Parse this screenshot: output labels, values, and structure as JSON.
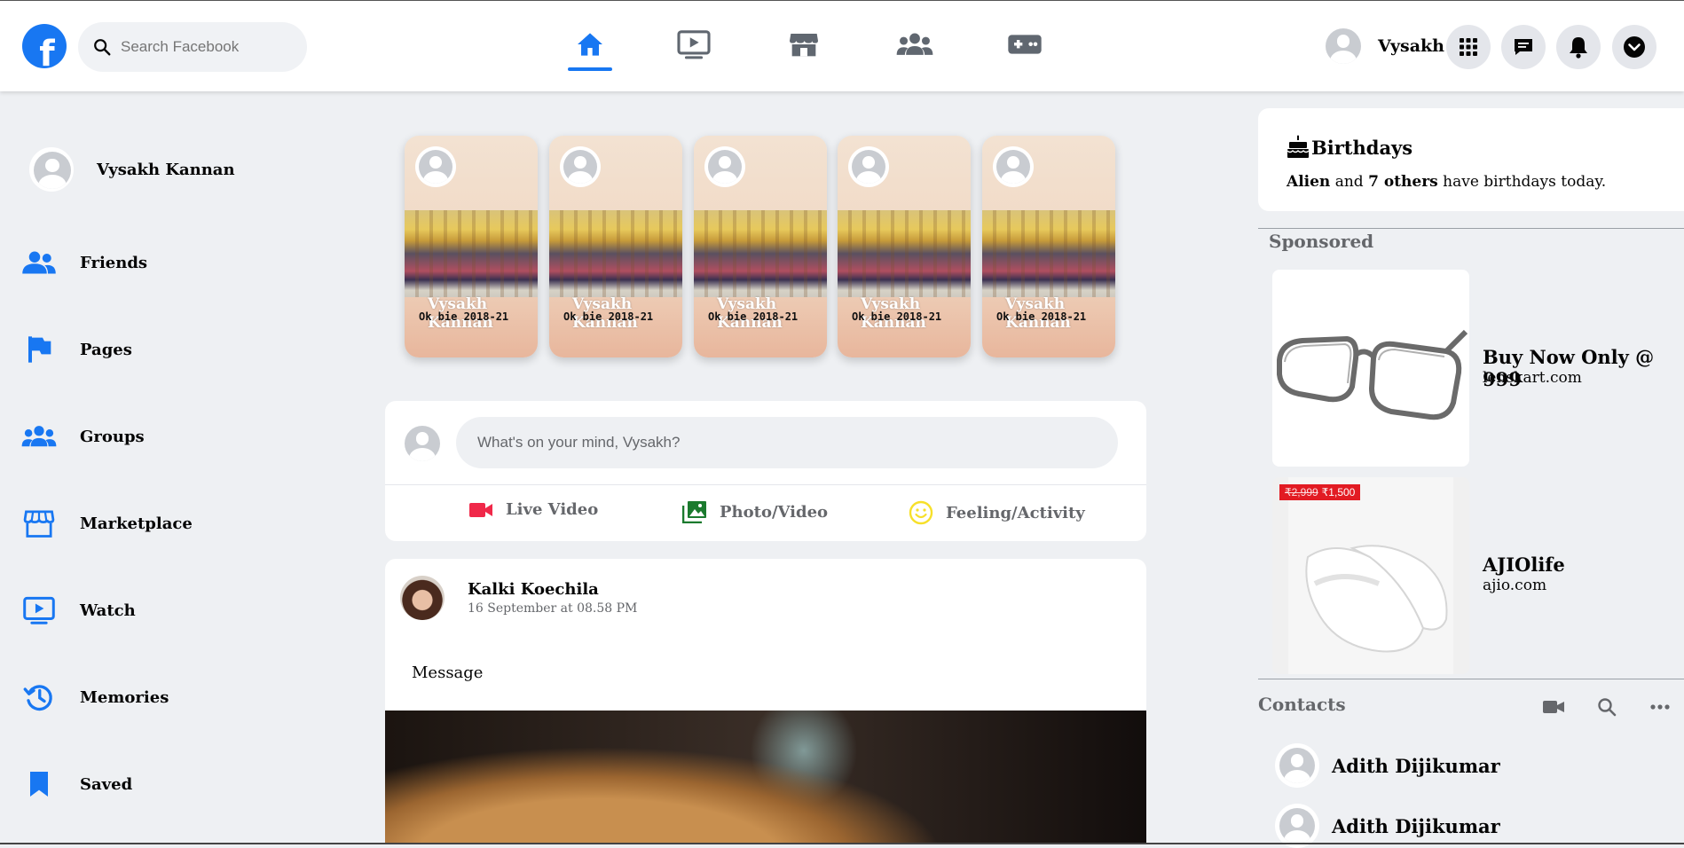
{
  "header": {
    "logo": "f",
    "search_placeholder": "Search Facebook",
    "nav": [
      "home-icon",
      "watch-icon",
      "marketplace-icon",
      "groups-icon",
      "gaming-icon"
    ],
    "active_nav": "home-icon",
    "profile_name": "Vysakh",
    "actions": [
      "menu-grid-icon",
      "messenger-icon",
      "notifications-icon",
      "account-dropdown-icon"
    ]
  },
  "sidebar": {
    "profile_name": "Vysakh Kannan",
    "items": [
      {
        "label": "Friends",
        "icon": "friends-icon"
      },
      {
        "label": "Pages",
        "icon": "flag-icon"
      },
      {
        "label": "Groups",
        "icon": "groups-icon"
      },
      {
        "label": "Marketplace",
        "icon": "store-icon"
      },
      {
        "label": "Watch",
        "icon": "watch-icon"
      },
      {
        "label": "Memories",
        "icon": "memories-icon"
      },
      {
        "label": "Saved",
        "icon": "bookmark-icon"
      }
    ]
  },
  "stories": [
    {
      "name": "Vysakh Kannan",
      "caption": "Ok bie 2018-21"
    },
    {
      "name": "Vysakh Kannan",
      "caption": "Ok bie 2018-21"
    },
    {
      "name": "Vysakh Kannan",
      "caption": "Ok bie 2018-21"
    },
    {
      "name": "Vysakh Kannan",
      "caption": "Ok bie 2018-21"
    },
    {
      "name": "Vysakh Kannan",
      "caption": "Ok bie 2018-21"
    }
  ],
  "composer": {
    "placeholder": "What's on your mind, Vysakh?",
    "actions": [
      {
        "label": "Live Video",
        "icon": "live-video-icon",
        "color": "#f3425f"
      },
      {
        "label": "Photo/Video",
        "icon": "photo-icon",
        "color": "#45bd62"
      },
      {
        "label": "Feeling/Activity",
        "icon": "feeling-icon",
        "color": "#f7b928"
      }
    ]
  },
  "post": {
    "author": "Kalki Koechila",
    "timestamp": "16 September at 08.58 PM",
    "message": "Message"
  },
  "birthdays": {
    "title": "Birthdays",
    "name": "Alien",
    "and": "and",
    "others": "7 others",
    "suffix": "have birthdays today."
  },
  "sponsored": {
    "title": "Sponsored",
    "ads": [
      {
        "title": "Buy Now Only @ 999",
        "site": "lenskart.com"
      },
      {
        "title": "AJIOlife",
        "site": "ajio.com",
        "price_old": "₹2,999",
        "price_new": "₹1,500"
      }
    ]
  },
  "contacts": {
    "title": "Contacts",
    "list": [
      "Adith Dijikumar",
      "Adith Dijikumar"
    ]
  },
  "colors": {
    "brand": "#1877f2",
    "background": "#eef0f3",
    "secondary_text": "#65676b"
  }
}
